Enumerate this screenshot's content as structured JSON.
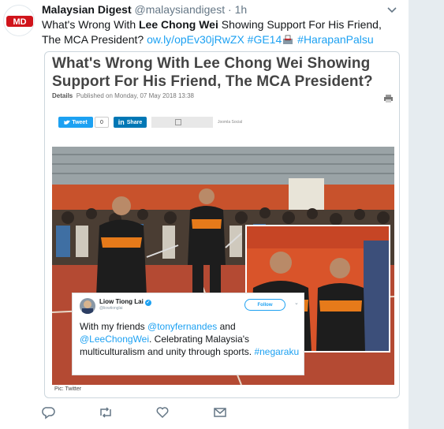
{
  "tweet": {
    "author_name": "Malaysian Digest",
    "author_handle": "@malaysiandigest",
    "separator": "·",
    "time": "1h",
    "text_part1": "What's Wrong With ",
    "text_bold": "Lee Chong Wei",
    "text_part2": " Showing Support For His Friend, The MCA President? ",
    "link": "ow.ly/opEv30jRwZX",
    "hashtag1": "#GE14",
    "hashtag2": "#HarapanPalsu",
    "avatar_logo_text": "MD"
  },
  "article": {
    "title": "What's Wrong With Lee Chong Wei Showing Support For His Friend, The MCA President?",
    "meta_label": "Details",
    "meta_published": "Published on Monday, 07 May 2018 13:38",
    "tweet_button": "Tweet",
    "tweet_count": "0",
    "share_in": "in",
    "share_button": "Share",
    "social_label": "Joomla Social",
    "caption": "Pic: Twitter"
  },
  "embedded_tweet": {
    "name": "Liow Tiong Lai",
    "handle": "@liowtionglai",
    "follow": "Follow",
    "text_part1": "With my friends ",
    "mention1": "@tonyfernandes",
    "text_part2": " and ",
    "mention2": "@LeeChongWei",
    "text_part3": ". Celebrating Malaysia's multiculturalism and unity through sports. ",
    "hashtag": "#negaraku"
  },
  "actions": {
    "reply": "reply-icon",
    "retweet": "retweet-icon",
    "like": "like-icon",
    "dm": "direct-message-icon"
  },
  "colors": {
    "link": "#1da1f2",
    "brand_red": "#d0141b",
    "muted": "#657786",
    "background_strip": "#e6ecf0"
  }
}
